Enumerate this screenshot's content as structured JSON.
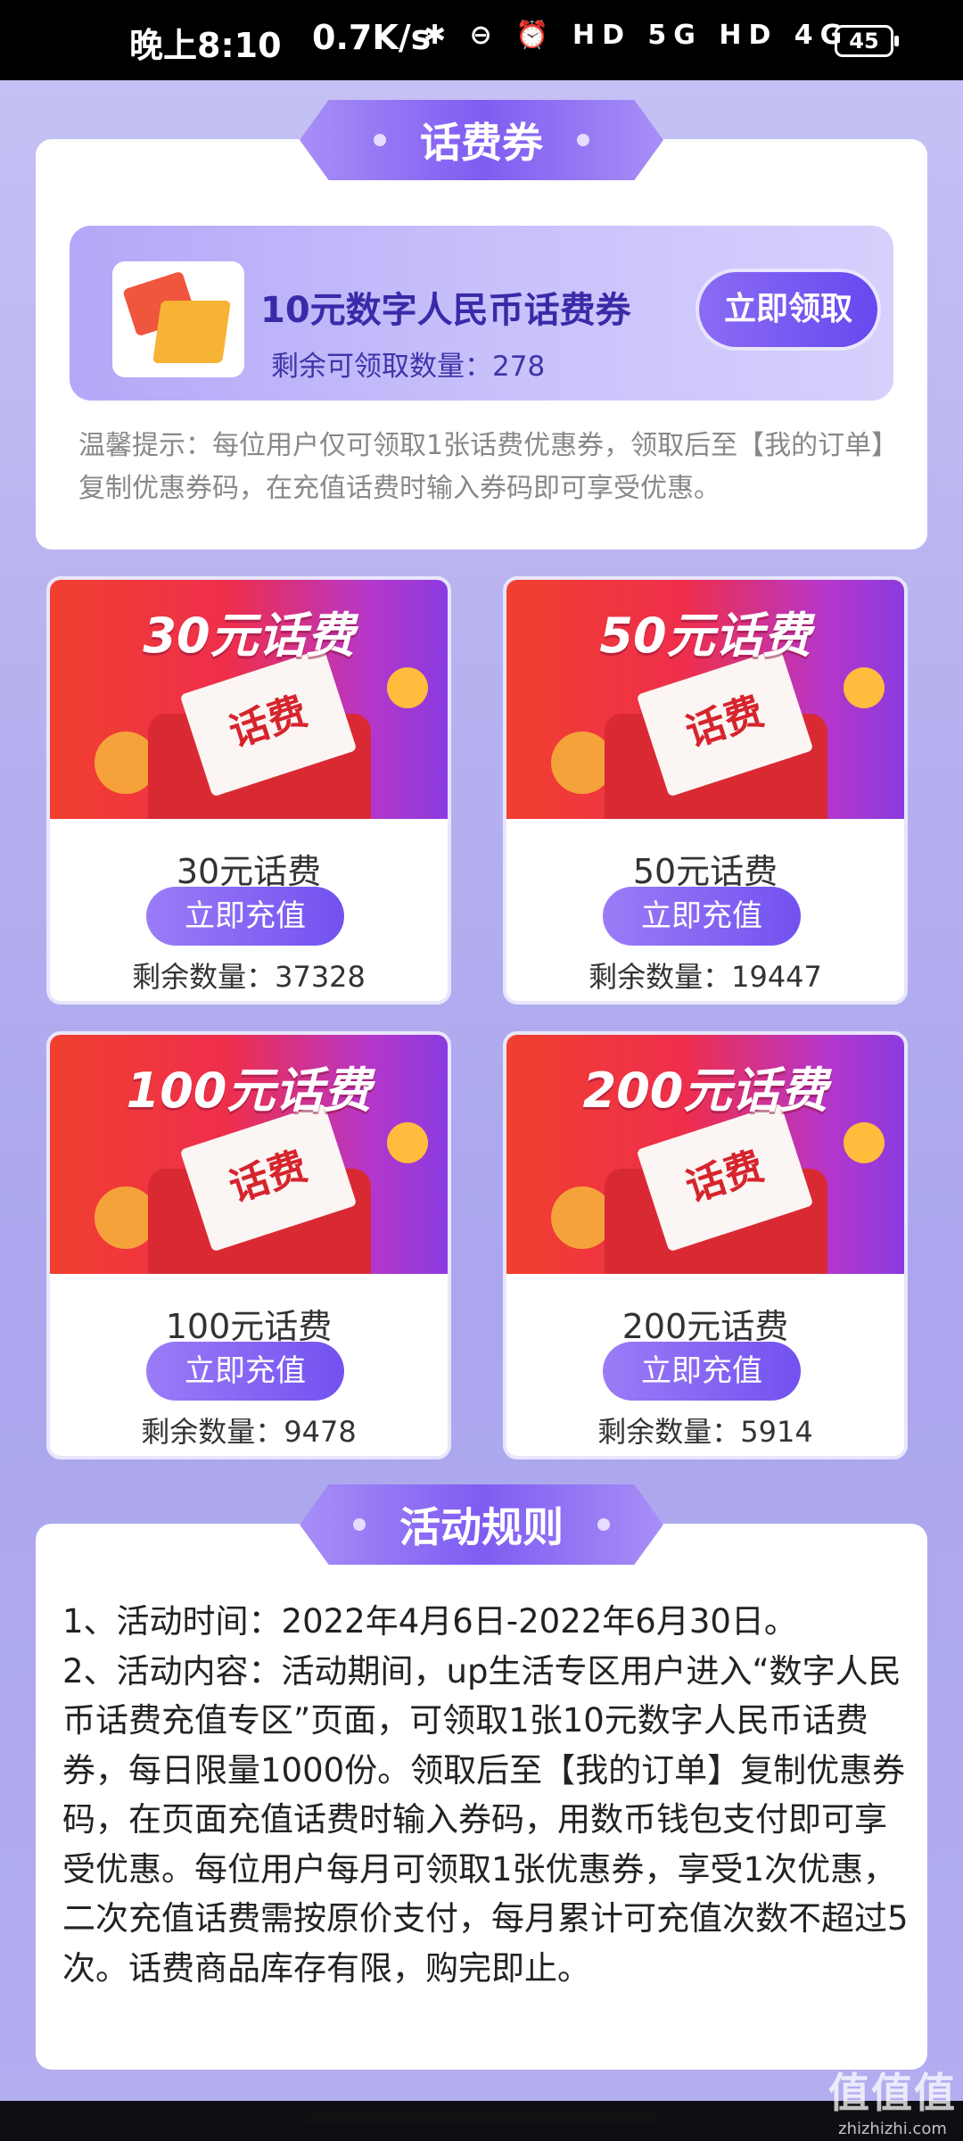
{
  "status_bar": {
    "time": "晚上8:10",
    "speed": "0.7K/s",
    "icons": "✱ ⊖ ⏰ HD 5G HD 4G",
    "battery": "45"
  },
  "coupon_section": {
    "title": "话费券",
    "coupon_title": "10元数字人民币话费券",
    "remaining_label": "剩余可领取数量：278",
    "claim_button": "立即领取",
    "tip": "温馨提示：每位用户仅可领取1张话费优惠券，领取后至【我的订单】复制优惠券码，在充值话费时输入券码即可享受优惠。"
  },
  "products": [
    {
      "banner": "30元话费",
      "ticket": "话费",
      "name": "30元话费",
      "button": "立即充值",
      "stock": "剩余数量：37328"
    },
    {
      "banner": "50元话费",
      "ticket": "话费",
      "name": "50元话费",
      "button": "立即充值",
      "stock": "剩余数量：19447"
    },
    {
      "banner": "100元话费",
      "ticket": "话费",
      "name": "100元话费",
      "button": "立即充值",
      "stock": "剩余数量：9478"
    },
    {
      "banner": "200元话费",
      "ticket": "话费",
      "name": "200元话费",
      "button": "立即充值",
      "stock": "剩余数量：5914"
    }
  ],
  "rules": {
    "title": "活动规则",
    "line1": "1、活动时间：2022年4月6日-2022年6月30日。",
    "line2": "2、活动内容：活动期间，up生活专区用户进入“数字人民币话费充值专区”页面，可领取1张10元数字人民币话费券，每日限量1000份。领取后至【我的订单】复制优惠券码，在页面充值话费时输入券码，用数币钱包支付即可享受优惠。每位用户每月可领取1张优惠券，享受1次优惠，二次充值话费需按原价支付，每月累计可充值次数不超过5次。话费商品库存有限，购完即止。"
  },
  "watermark": {
    "big": "值值值",
    "small": "zhizhizhi.com"
  }
}
